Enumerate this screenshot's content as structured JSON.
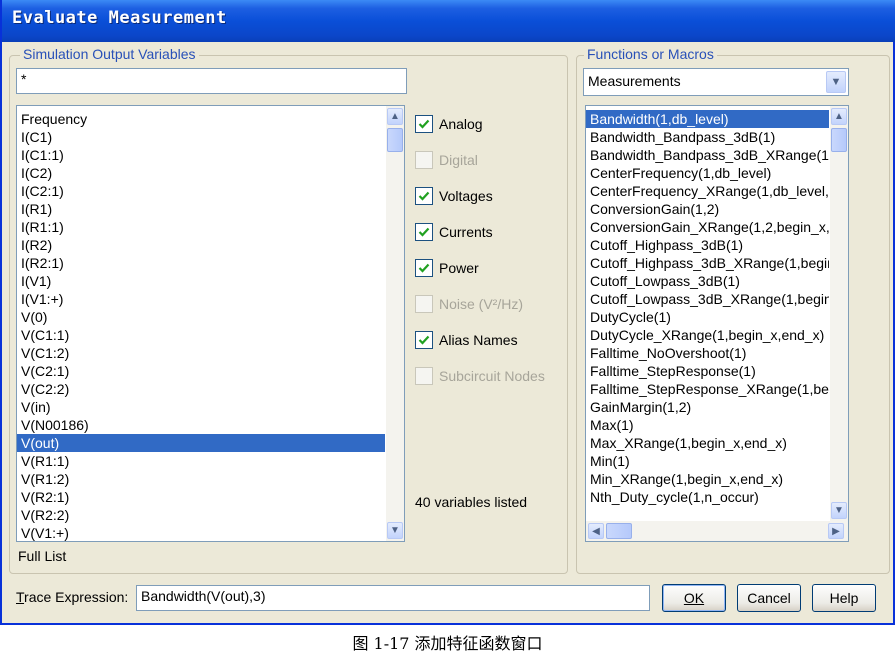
{
  "window": {
    "title": "Evaluate Measurement"
  },
  "simulation_output": {
    "legend": "Simulation Output Variables",
    "filter_value": "*",
    "variables": [
      "Frequency",
      "I(C1)",
      "I(C1:1)",
      "I(C2)",
      "I(C2:1)",
      "I(R1)",
      "I(R1:1)",
      "I(R2)",
      "I(R2:1)",
      "I(V1)",
      "I(V1:+)",
      "V(0)",
      "V(C1:1)",
      "V(C1:2)",
      "V(C2:1)",
      "V(C2:2)",
      "V(in)",
      "V(N00186)",
      "V(out)",
      "V(R1:1)",
      "V(R1:2)",
      "V(R2:1)",
      "V(R2:2)",
      "V(V1:+)"
    ],
    "selected_variable": "V(out)",
    "full_list_label": "Full List"
  },
  "filters": {
    "items": [
      {
        "label": "Analog",
        "checked": true,
        "enabled": true
      },
      {
        "label": "Digital",
        "checked": false,
        "enabled": false
      },
      {
        "label": "Voltages",
        "checked": true,
        "enabled": true
      },
      {
        "label": "Currents",
        "checked": true,
        "enabled": true
      },
      {
        "label": "Power",
        "checked": true,
        "enabled": true
      },
      {
        "label": "Noise (V²/Hz)",
        "checked": false,
        "enabled": false
      },
      {
        "label": "Alias Names",
        "checked": true,
        "enabled": true
      },
      {
        "label": "Subcircuit Nodes",
        "checked": false,
        "enabled": false
      }
    ],
    "count_text": "40 variables listed"
  },
  "functions": {
    "legend": "Functions or Macros",
    "dropdown_value": "Measurements",
    "items": [
      "Bandwidth(1,db_level)",
      "Bandwidth_Bandpass_3dB(1)",
      "Bandwidth_Bandpass_3dB_XRange(1,",
      "CenterFrequency(1,db_level)",
      "CenterFrequency_XRange(1,db_level,b",
      "ConversionGain(1,2)",
      "ConversionGain_XRange(1,2,begin_x,e",
      "Cutoff_Highpass_3dB(1)",
      "Cutoff_Highpass_3dB_XRange(1,begin",
      "Cutoff_Lowpass_3dB(1)",
      "Cutoff_Lowpass_3dB_XRange(1,begin_",
      "DutyCycle(1)",
      "DutyCycle_XRange(1,begin_x,end_x)",
      "Falltime_NoOvershoot(1)",
      "Falltime_StepResponse(1)",
      "Falltime_StepResponse_XRange(1,beg",
      "GainMargin(1,2)",
      "Max(1)",
      "Max_XRange(1,begin_x,end_x)",
      "Min(1)",
      "Min_XRange(1,begin_x,end_x)",
      "Nth_Duty_cycle(1,n_occur)"
    ],
    "selected_item": "Bandwidth(1,db_level)"
  },
  "trace": {
    "label": "Trace Expression:",
    "value": "Bandwidth(V(out),3)"
  },
  "buttons": {
    "ok": "OK",
    "cancel": "Cancel",
    "help": "Help"
  },
  "caption": "图 1-17  添加特征函数窗口",
  "colors": {
    "titlebar": "#0a4fd8",
    "selection": "#316ac5",
    "face": "#ece9d8",
    "check": "#21a121"
  }
}
